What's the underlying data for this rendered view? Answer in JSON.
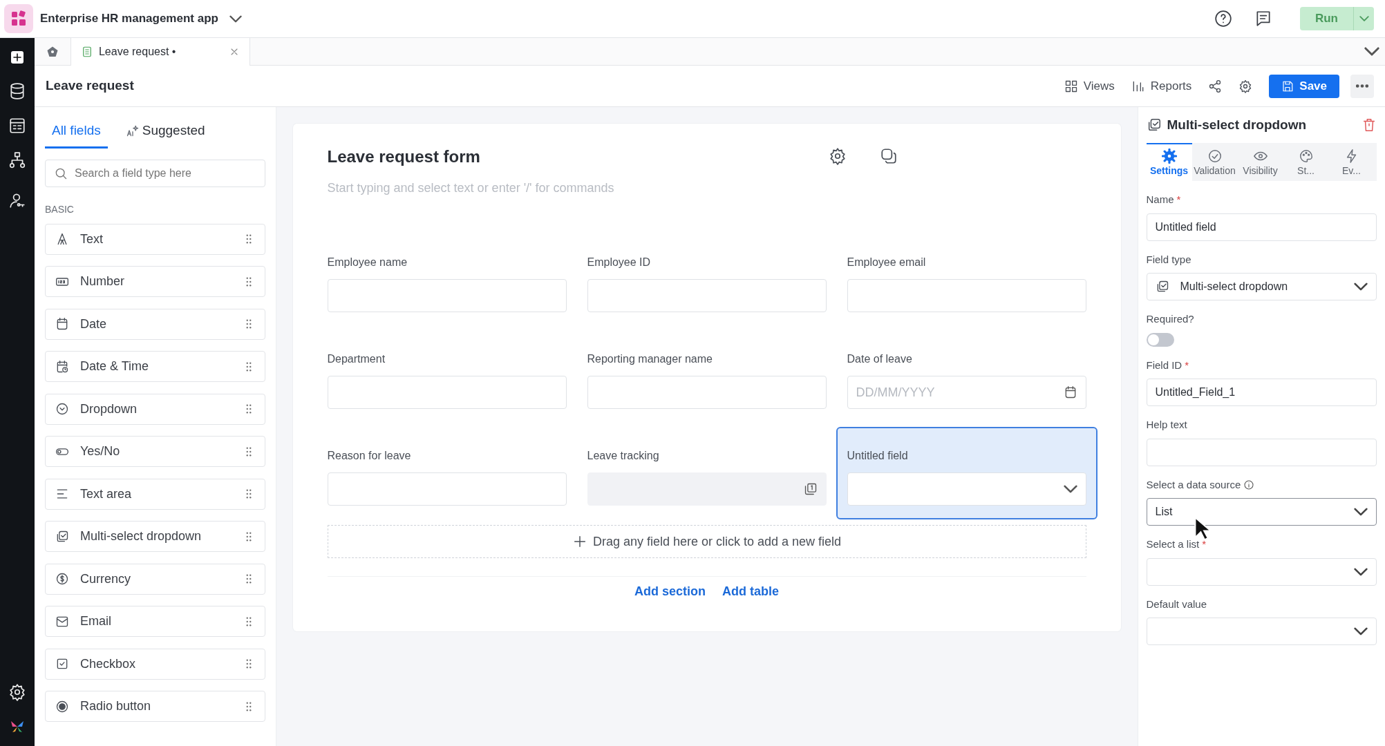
{
  "app": {
    "title": "Enterprise HR management app",
    "run_label": "Run"
  },
  "tabs": [
    {
      "label": "Leave request •",
      "selected": true
    }
  ],
  "page": {
    "title": "Leave request",
    "toolbar": [
      {
        "kind": "views",
        "label": "Views"
      },
      {
        "kind": "reports",
        "label": "Reports"
      },
      {
        "kind": "share"
      },
      {
        "kind": "gear"
      }
    ],
    "save_label": "Save"
  },
  "left_panel": {
    "tabs": [
      {
        "label": "All fields",
        "selected": true,
        "kind": "plain"
      },
      {
        "label": "Suggested",
        "selected": false,
        "kind": "ai"
      }
    ],
    "search": {
      "placeholder": "Search a field type here"
    },
    "section": "BASIC",
    "field_types": [
      {
        "label": "Text",
        "kind": "text"
      },
      {
        "label": "Number",
        "kind": "number"
      },
      {
        "label": "Date",
        "kind": "date"
      },
      {
        "label": "Date & Time",
        "kind": "datetime"
      },
      {
        "label": "Dropdown",
        "kind": "dropdown"
      },
      {
        "label": "Yes/No",
        "kind": "yesno"
      },
      {
        "label": "Text area",
        "kind": "textarea"
      },
      {
        "label": "Multi-select dropdown",
        "kind": "multiselect"
      },
      {
        "label": "Currency",
        "kind": "currency"
      },
      {
        "label": "Email",
        "kind": "email"
      },
      {
        "label": "Checkbox",
        "kind": "checkbox"
      },
      {
        "label": "Radio button",
        "kind": "radio"
      }
    ]
  },
  "form": {
    "title": "Leave request form",
    "placeholder": "Start typing and select text or enter '/' for commands",
    "fields": [
      {
        "label": "Employee name",
        "kind": "text",
        "selected": false
      },
      {
        "label": "Employee ID",
        "kind": "text",
        "selected": false
      },
      {
        "label": "Employee email",
        "kind": "text",
        "selected": false
      },
      {
        "label": "Department",
        "kind": "text",
        "selected": false
      },
      {
        "label": "Reporting manager name",
        "kind": "text",
        "selected": false
      },
      {
        "label": "Date of leave",
        "kind": "date",
        "placeholder": "DD/MM/YYYY",
        "selected": false
      },
      {
        "label": "Reason for leave",
        "kind": "text",
        "selected": false
      },
      {
        "label": "Leave tracking",
        "kind": "tracking",
        "selected": false
      },
      {
        "label": "Untitled field",
        "kind": "dropdown",
        "selected": true
      }
    ],
    "drop_zone": "Drag any field here or click to add a new field",
    "links": [
      "Add section",
      "Add table"
    ]
  },
  "properties": {
    "title": "Multi-select dropdown",
    "tabs": [
      {
        "label": "Settings",
        "kind": "settings",
        "selected": true
      },
      {
        "label": "Validation",
        "kind": "validation",
        "selected": false
      },
      {
        "label": "Visibility",
        "kind": "visibility",
        "selected": false
      },
      {
        "label": "St...",
        "kind": "style",
        "selected": false
      },
      {
        "label": "Ev...",
        "kind": "events",
        "selected": false
      }
    ],
    "fields": [
      {
        "label": "Name",
        "kind": "input",
        "marker": "*",
        "value": "Untitled field"
      },
      {
        "label": "Field type",
        "kind": "select",
        "value": "Multi-select dropdown",
        "icon": true
      },
      {
        "label": "Required?",
        "kind": "toggle",
        "on": false
      },
      {
        "label": "Field ID",
        "kind": "input",
        "marker": "*",
        "value": "Untitled_Field_1"
      },
      {
        "label": "Help text",
        "kind": "input"
      },
      {
        "label": "Select a data source",
        "kind": "select",
        "info": true,
        "value": "List"
      },
      {
        "label": "Select a list",
        "kind": "select",
        "marker": "*"
      },
      {
        "label": "Default value",
        "kind": "select"
      }
    ]
  }
}
